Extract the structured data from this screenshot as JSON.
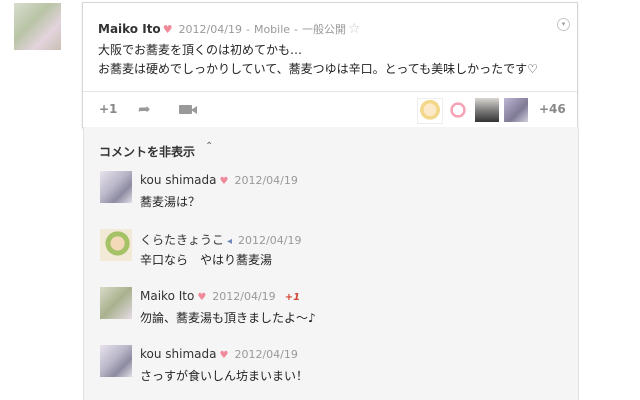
{
  "post": {
    "author": "Maiko Ito",
    "author_mark": "♥",
    "date": "2012/04/19",
    "separator": "-",
    "via": "Mobile",
    "visibility": "一般公開",
    "star": "☆",
    "menu_icon": "▾",
    "lines": [
      "大阪でお蕎麦を頂くのは初めてかも…",
      "お蕎麦は硬めでしっかりしていて、蕎麦つゆは辛口。とっても美味しかったです♡"
    ],
    "plus_one": "+1",
    "share_icon": "➦",
    "sharers_count": "+46"
  },
  "comments_section": {
    "toggle_label": "コメントを非表示",
    "toggle_icon": "⌃",
    "comments": [
      {
        "author": "kou shimada",
        "mark": "♥",
        "date": "2012/04/19",
        "plus": "",
        "text": "蕎麦湯は？"
      },
      {
        "author": "くらたきょうこ",
        "mark": "◂",
        "date": "2012/04/19",
        "plus": "",
        "text": "辛口なら　やはり蕎麦湯"
      },
      {
        "author": "Maiko Ito",
        "mark": "♥",
        "date": "2012/04/19",
        "plus": "+1",
        "text": "勿論、蕎麦湯も頂きましたよ〜♪"
      },
      {
        "author": "kou shimada",
        "mark": "♥",
        "date": "2012/04/19",
        "plus": "",
        "text": "さっすが食いしん坊まいまい！"
      }
    ]
  }
}
